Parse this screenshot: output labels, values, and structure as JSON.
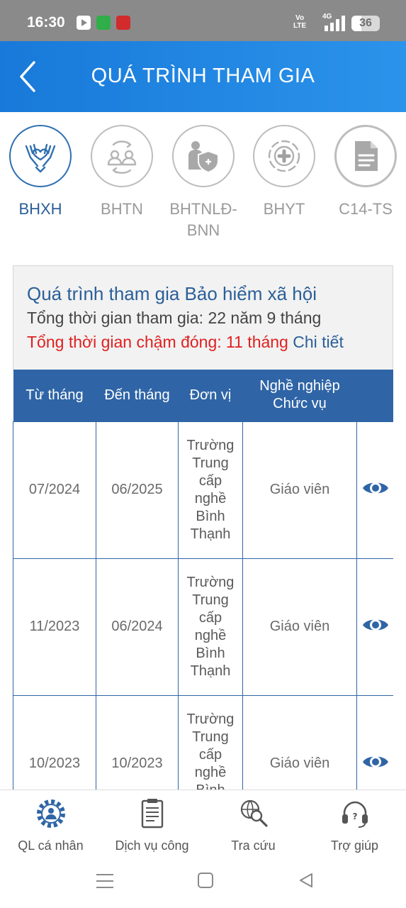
{
  "status_bar": {
    "time": "16:30",
    "network_volte": "Vo LTE",
    "network_type": "4G",
    "battery": "36"
  },
  "header": {
    "title": "QUÁ TRÌNH THAM GIA",
    "back_icon": "chevron-left-icon"
  },
  "tabs": [
    {
      "label": "BHXH",
      "icon": "hands-heart-icon",
      "active": true
    },
    {
      "label": "BHTN",
      "icon": "people-exchange-icon",
      "active": false
    },
    {
      "label": "BHTNLĐ-BNN",
      "label_line1": "BHTNLĐ-",
      "label_line2": "BNN",
      "icon": "worker-shield-icon",
      "active": false
    },
    {
      "label": "BHYT",
      "icon": "medical-cross-icon",
      "active": false
    },
    {
      "label": "C14-TS",
      "icon": "document-icon",
      "active": false
    }
  ],
  "summary": {
    "title": "Quá trình tham gia Bảo hiểm xã hội",
    "total_line": "Tổng thời gian tham gia: 22 năm 9 tháng",
    "late_line": "Tổng thời gian chậm đóng: 11 tháng",
    "detail_link": "Chi tiết"
  },
  "table": {
    "headers": {
      "from": "Từ tháng",
      "to": "Đến tháng",
      "unit": "Đơn vị",
      "job_line1": "Nghề nghiệp",
      "job_line2": "Chức vụ"
    },
    "rows": [
      {
        "from": "07/2024",
        "to": "06/2025",
        "unit": "Trường Trung cấp nghề Bình Thạnh",
        "job": "Giáo viên"
      },
      {
        "from": "11/2023",
        "to": "06/2024",
        "unit": "Trường Trung cấp nghề Bình Thạnh",
        "job": "Giáo viên"
      },
      {
        "from": "10/2023",
        "to": "10/2023",
        "unit": "Trường Trung cấp nghề Bình Thạnh",
        "job": "Giáo viên"
      }
    ],
    "view_icon": "eye-icon"
  },
  "bottom_nav": [
    {
      "label": "QL cá nhân",
      "icon": "personal-gear-icon"
    },
    {
      "label": "Dịch vụ công",
      "icon": "clipboard-icon"
    },
    {
      "label": "Tra cứu",
      "icon": "globe-search-icon"
    },
    {
      "label": "Trợ giúp",
      "icon": "headset-icon"
    }
  ],
  "colors": {
    "header_blue": "#1f86e0",
    "primary_dark_blue": "#2f65a6",
    "link_blue": "#2b5f98",
    "late_red": "#e02020"
  }
}
